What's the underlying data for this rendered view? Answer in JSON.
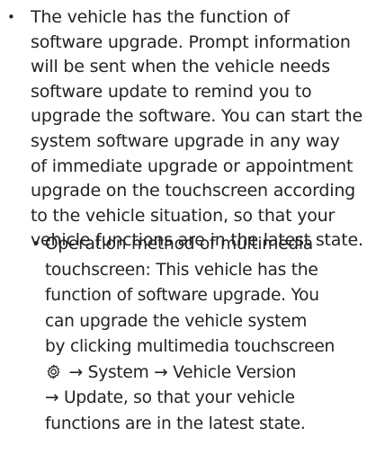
{
  "paragraph_1": {
    "bullet": "•",
    "lines": [
      "The vehicle has the function of",
      "software upgrade. Prompt information",
      "will be sent when the vehicle needs",
      "software update to remind you to",
      "upgrade the software. You can start the",
      "system software upgrade in any way",
      "of immediate upgrade or appointment",
      "upgrade on the touchscreen according",
      "to the vehicle situation, so that your",
      "vehicle functions are in the latest state."
    ]
  },
  "paragraph_2": {
    "bullet": "•",
    "lines": [
      "Operation method of multimedia",
      "touchscreen: This vehicle has the",
      "function of software upgrade. You",
      "can upgrade the vehicle system",
      "by clicking multimedia touchscreen"
    ],
    "icon_line_icon": "gear-icon",
    "icon_line_text": " → System → Vehicle Version",
    "tail_lines": [
      "→ Update, so that your vehicle",
      "functions are in the latest state."
    ]
  }
}
